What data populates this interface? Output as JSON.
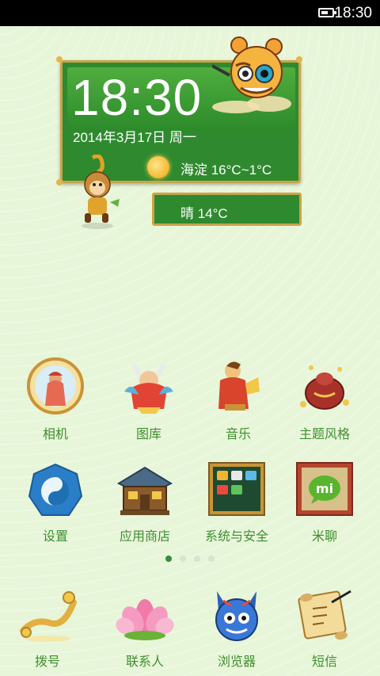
{
  "status_bar": {
    "time": "18:30",
    "battery_level_pct": 80
  },
  "clock_widget": {
    "time": "18:30",
    "date": "2014年3月17日 周一",
    "weather_location_temp": "海淀  16°C~1°C",
    "weather_condition_temp": "晴  14°C"
  },
  "apps_row1": [
    {
      "label": "相机",
      "icon": "camera-icon"
    },
    {
      "label": "图库",
      "icon": "gallery-icon"
    },
    {
      "label": "音乐",
      "icon": "music-icon"
    },
    {
      "label": "主题风格",
      "icon": "themes-icon"
    }
  ],
  "apps_row2": [
    {
      "label": "设置",
      "icon": "settings-icon"
    },
    {
      "label": "应用商店",
      "icon": "app-store-icon"
    },
    {
      "label": "系统与安全",
      "icon": "security-icon"
    },
    {
      "label": "米聊",
      "icon": "miliao-icon"
    }
  ],
  "dock": [
    {
      "label": "拨号",
      "icon": "phone-icon"
    },
    {
      "label": "联系人",
      "icon": "contacts-icon"
    },
    {
      "label": "浏览器",
      "icon": "browser-icon"
    },
    {
      "label": "短信",
      "icon": "messages-icon"
    }
  ],
  "page_indicator": {
    "current": 1,
    "total": 4
  },
  "colors": {
    "label": "#3f8f30",
    "widget_green": "#2f8a2f",
    "frame_gold": "#c9a44a"
  }
}
